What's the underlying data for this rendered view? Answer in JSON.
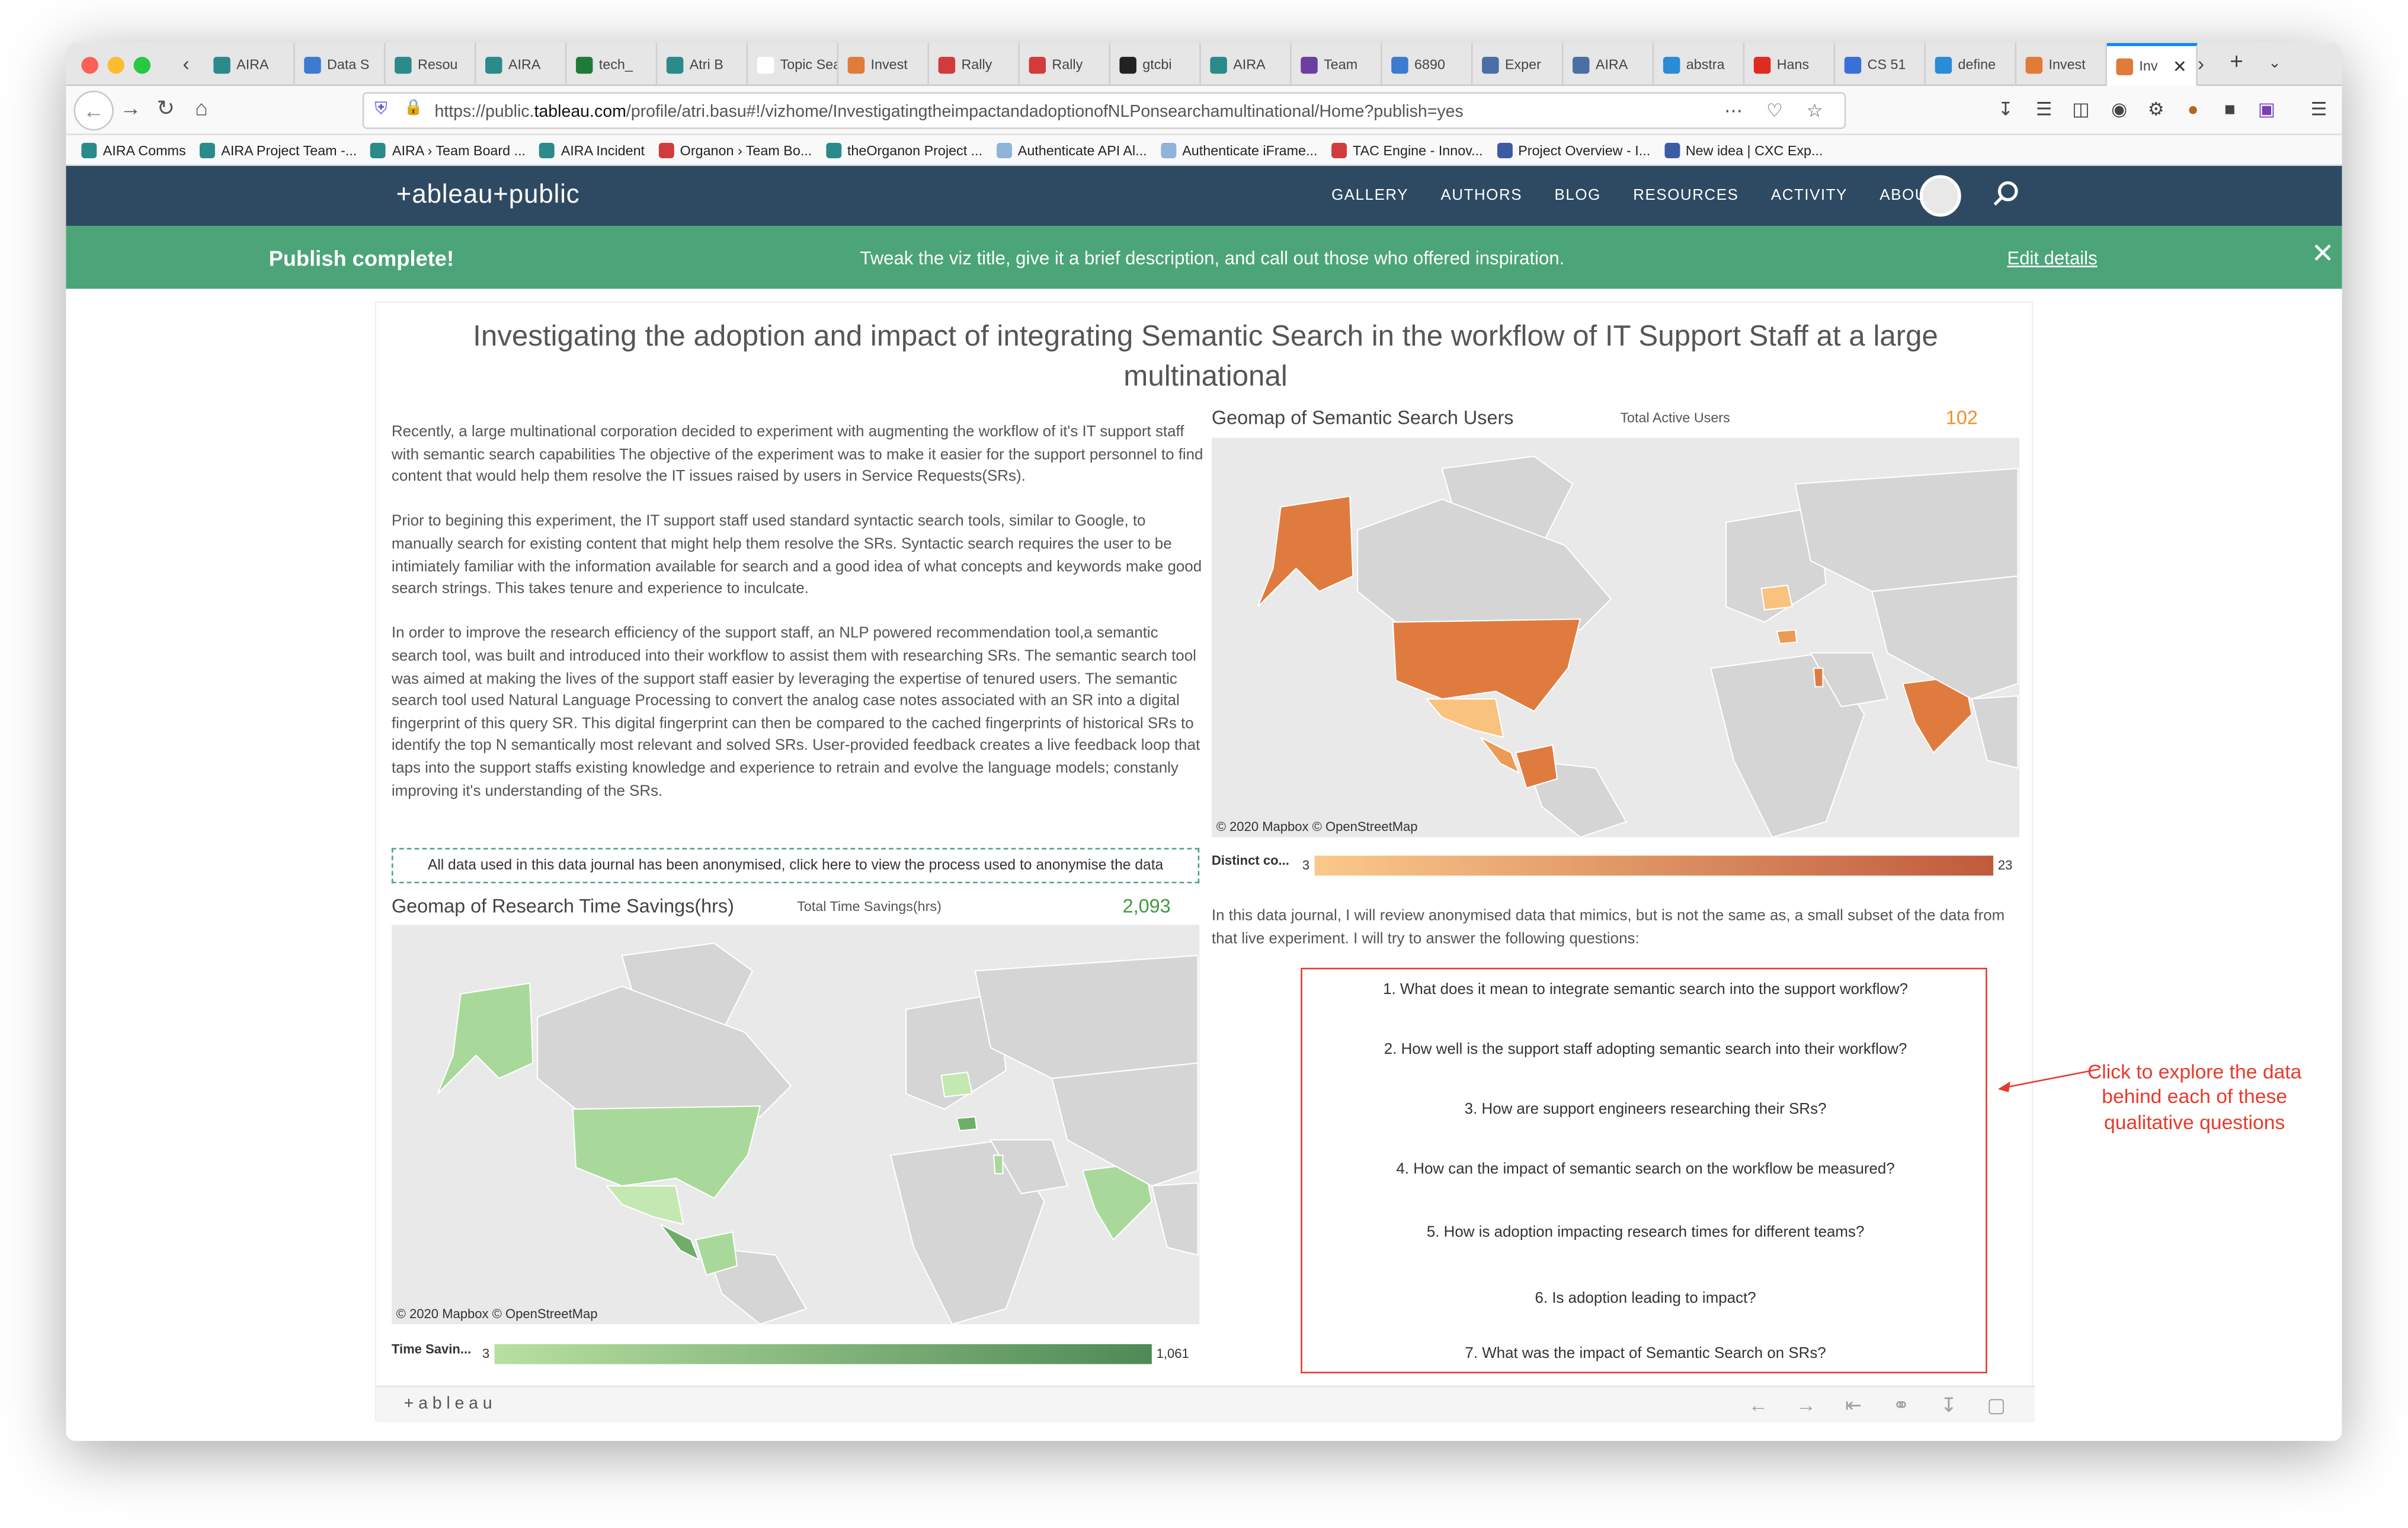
{
  "browser": {
    "tabs": [
      {
        "label": "AIRA",
        "color": "#2b8a8a"
      },
      {
        "label": "Data S",
        "color": "#3b7bd1"
      },
      {
        "label": "Resou",
        "color": "#2b8a8a"
      },
      {
        "label": "AIRA",
        "color": "#2b8a8a"
      },
      {
        "label": "tech_",
        "color": "#1f7a3a"
      },
      {
        "label": "Atri B",
        "color": "#2b8a8a"
      },
      {
        "label": "Topic Sear",
        "color": "#ffffff"
      },
      {
        "label": "Invest",
        "color": "#e07b39"
      },
      {
        "label": "Rally",
        "color": "#d23b3b"
      },
      {
        "label": "Rally",
        "color": "#d23b3b"
      },
      {
        "label": "gtcbi",
        "color": "#222222"
      },
      {
        "label": "AIRA",
        "color": "#2b8a8a"
      },
      {
        "label": "Team",
        "color": "#6b3fa0"
      },
      {
        "label": "6890",
        "color": "#3b7bd1"
      },
      {
        "label": "Exper",
        "color": "#4a6fa5"
      },
      {
        "label": "AIRA",
        "color": "#4a6fa5"
      },
      {
        "label": "abstra",
        "color": "#2a8bd6"
      },
      {
        "label": "Hans",
        "color": "#e02b20"
      },
      {
        "label": "CS 51",
        "color": "#3a6fd8"
      },
      {
        "label": "define",
        "color": "#2a8bd6"
      },
      {
        "label": "Invest",
        "color": "#e07b39"
      },
      {
        "label": "Inv",
        "color": "#e07b39"
      }
    ],
    "url_prefix": "https://public.",
    "url_domain": "tableau.com",
    "url_rest": "/profile/atri.basu#!/vizhome/InvestigatingtheimpactandadoptionofNLPonsearchamultinational/Home?publish=yes",
    "bookmarks": [
      {
        "label": "AIRA Comms",
        "color": "#2b8a8a"
      },
      {
        "label": "AIRA Project Team -...",
        "color": "#2b8a8a"
      },
      {
        "label": "AIRA › Team Board ...",
        "color": "#2b8a8a"
      },
      {
        "label": "AIRA Incident",
        "color": "#2b8a8a"
      },
      {
        "label": "Organon › Team Bo...",
        "color": "#d23b3b"
      },
      {
        "label": "theOrganon Project ...",
        "color": "#2b8a8a"
      },
      {
        "label": "Authenticate API Al...",
        "color": "#8fb3d9"
      },
      {
        "label": "Authenticate iFrame...",
        "color": "#8fb3d9"
      },
      {
        "label": "TAC Engine - Innov...",
        "color": "#d23b3b"
      },
      {
        "label": "Project Overview - I...",
        "color": "#3b5ba5"
      },
      {
        "label": "New idea | CXC Exp...",
        "color": "#3b5ba5"
      }
    ]
  },
  "site": {
    "logo": "+ableau+public",
    "menu": [
      "GALLERY",
      "AUTHORS",
      "BLOG",
      "RESOURCES",
      "ACTIVITY",
      "ABOUT"
    ]
  },
  "banner": {
    "title": "Publish complete!",
    "message": "Tweak the viz title, give it a brief description, and call out those who offered inspiration.",
    "link": "Edit details"
  },
  "viz": {
    "title": "Investigating the adoption and impact of integrating Semantic Search in the workflow of IT Support Staff at a large multinational",
    "intro": [
      "Recently, a large multinational corporation decided to experiment with augmenting the workflow of it's IT support staff with semantic search capabilities The objective of the experiment was to make it easier for the support personnel to find content that would help them resolve the IT issues raised by users in Service Requests(SRs).",
      "Prior to begining this experiment, the IT support staff used standard syntactic search tools, similar to Google, to manually search for existing content that might help them resolve the SRs. Syntactic search requires the user to be intimiately familiar with the information available for search and a good idea of what concepts and keywords make good search strings. This takes tenure and experience to inculcate.",
      "In order to improve the research efficiency of the support staff, an NLP powered recommendation tool,a semantic search tool, was built  and introduced into their workflow to assist them with researching SRs. The semantic search tool was aimed at making the lives of the support staff easier by leveraging the expertise of tenured users. The semantic search tool used Natural Language Processing to convert the analog case notes associated with an SR into a digital fingerprint of this query SR. This digital fingerprint can then be compared to the cached fingerprints of historical SRs to identify the top N semantically most relevant and solved SRs. User-provided feedback creates a live feedback loop that taps into the support staffs existing knowledge and experience to retrain and evolve the language models; constanly improving it's understanding of the SRs."
    ],
    "anon_note": "All data used in this data journal has been anonymised, click here to view the process used to anonymise the data",
    "users_map": {
      "title": "Geomap of Semantic Search Users",
      "kpi_label": "Total Active Users",
      "kpi_value": "102",
      "kpi_color": "#f28e2b",
      "credit": "© 2020 Mapbox  © OpenStreetMap",
      "legend_label": "Distinct co...",
      "legend_min": "3",
      "legend_max": "23",
      "color_low": "#fbc98a",
      "color_high": "#c05a3c"
    },
    "savings_map": {
      "title": "Geomap of Research Time Savings(hrs)",
      "kpi_label": "Total Time Savings(hrs)",
      "kpi_value": "2,093",
      "kpi_color": "#3f9b3f",
      "credit": "© 2020 Mapbox  © OpenStreetMap",
      "legend_label": "Time Savin...",
      "legend_min": "3",
      "legend_max": "1,061",
      "color_low": "#b8e0a0",
      "color_high": "#4e8a56"
    },
    "journal_text": "In this data journal, I will review anonymised data that mimics, but is not the same as, a small subset of the data from that live experiment. I will try to answer the following questions:",
    "questions": [
      "1. What does it mean to integrate semantic search into the support workflow?",
      "2. How well is the support staff adopting semantic search into their workflow?",
      "3. How are support engineers researching their SRs?",
      "4. How can the impact of semantic search on the workflow be measured?",
      "5. How is adoption impacting research times for different teams?",
      "6. Is adoption leading to impact?",
      "7. What was the impact of Semantic Search on SRs?"
    ],
    "callout": "Click to explore the data behind each of these qualitative questions",
    "footer_logo": "+ableau"
  }
}
